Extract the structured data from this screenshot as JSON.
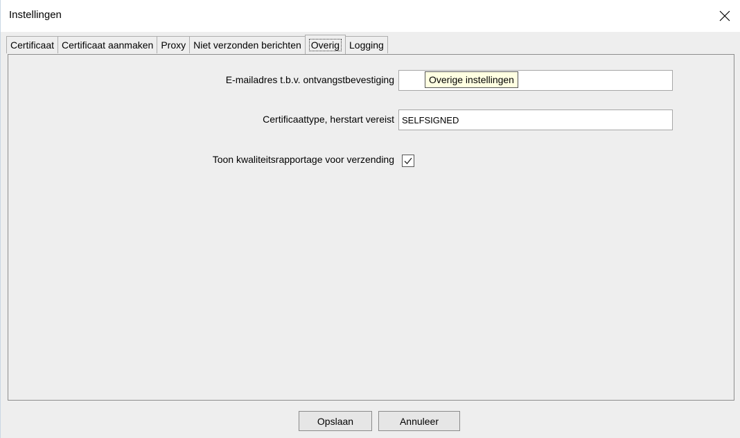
{
  "window": {
    "title": "Instellingen",
    "close_icon": "close-icon"
  },
  "tabs": [
    {
      "label": "Certificaat",
      "active": false
    },
    {
      "label": "Certificaat aanmaken",
      "active": false
    },
    {
      "label": "Proxy",
      "active": false
    },
    {
      "label": "Niet verzonden berichten",
      "active": false
    },
    {
      "label": "Overig",
      "active": true
    },
    {
      "label": "Logging",
      "active": false
    }
  ],
  "form": {
    "email": {
      "label": "E-mailadres t.b.v. ontvangstbevestiging",
      "value": ""
    },
    "certificate_type": {
      "label": "Certificaattype, herstart vereist",
      "value": "SELFSIGNED"
    },
    "quality_report": {
      "label": "Toon kwaliteitsrapportage voor verzending",
      "checked": true
    }
  },
  "tooltip": {
    "text": "Overige instellingen"
  },
  "footer": {
    "save_label": "Opslaan",
    "cancel_label": "Annuleer"
  }
}
